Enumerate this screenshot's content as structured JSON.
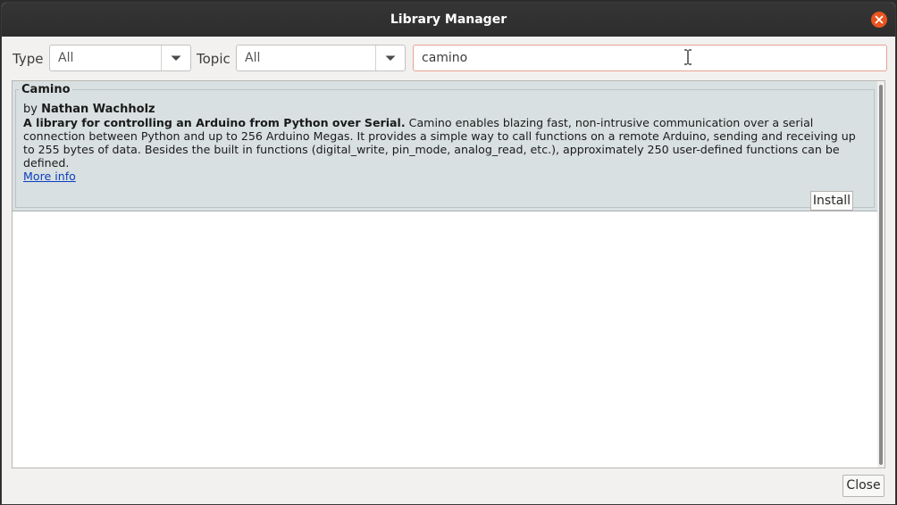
{
  "window": {
    "title": "Library Manager"
  },
  "filters": {
    "type_label": "Type",
    "type_value": "All",
    "topic_label": "Topic",
    "topic_value": "All",
    "search_value": "camino"
  },
  "results": [
    {
      "name": "Camino",
      "by_prefix": "by",
      "author": "Nathan Wachholz",
      "summary": "A library for controlling an Arduino from Python over Serial.",
      "description": " Camino enables blazing fast, non-intrusive communication over a serial connection between Python and up to 256 Arduino Megas. It provides a simple way to call functions on a remote Arduino, sending and receiving up to 255 bytes of data. Besides the built in functions (digital_write, pin_mode, analog_read, etc.), approximately 250 user-defined functions can be defined.",
      "more_info_label": "More info",
      "install_label": "Install"
    }
  ],
  "footer": {
    "close_label": "Close"
  },
  "icons": {
    "window_close": "close-icon",
    "dropdown": "chevron-down-icon",
    "cursor": "text-cursor-icon"
  },
  "colors": {
    "titlebar": "#2d2d2d",
    "close_accent": "#e9541f",
    "entry_background": "#d9e0e1",
    "link": "#0b3fbf"
  }
}
